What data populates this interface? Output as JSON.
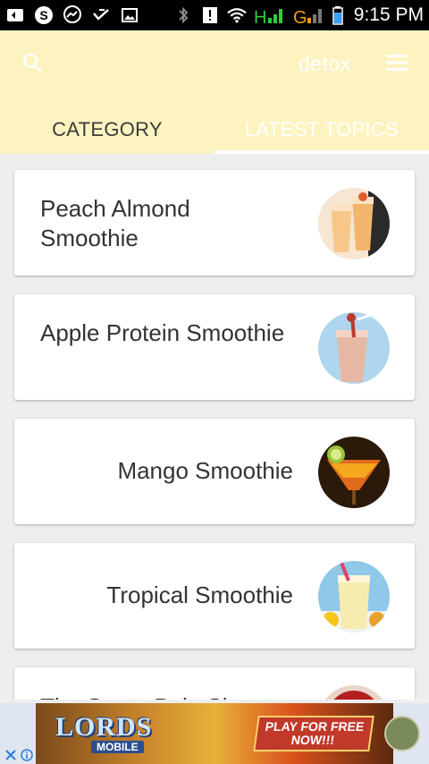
{
  "status_bar": {
    "time": "9:15 PM",
    "icons": [
      "message-icon",
      "skype-icon",
      "messenger-icon",
      "check-icon",
      "image-icon",
      "bluetooth-icon",
      "alert-icon",
      "wifi-icon",
      "h-signal-icon",
      "g-signal-icon",
      "battery-icon"
    ]
  },
  "app_bar": {
    "title": "detox",
    "search_icon": "search-icon",
    "menu_icon": "menu-icon",
    "background": "#fdf3c0"
  },
  "tabs": [
    {
      "label": "CATEGORY",
      "active": false
    },
    {
      "label": "LATEST TOPICS",
      "active": true
    }
  ],
  "recipes": [
    {
      "title": "Peach Almond Smoothie",
      "image": "peach-almond-smoothie-image"
    },
    {
      "title": "Apple Protein Smoothie",
      "image": "apple-protein-smoothie-image"
    },
    {
      "title": "Mango Smoothie",
      "image": "mango-smoothie-image"
    },
    {
      "title": "Tropical Smoothie",
      "image": "tropical-smoothie-image"
    },
    {
      "title": "The Stone Pale Sho...",
      "image": "stone-fruit-smoothie-image"
    }
  ],
  "ad": {
    "logo": "LORDS",
    "logo_sub": "MOBILE",
    "cta_line1": "PLAY FOR FREE",
    "cta_line2": "NOW!!!",
    "close_icon": "close-icon",
    "info_icon": "info-icon"
  }
}
